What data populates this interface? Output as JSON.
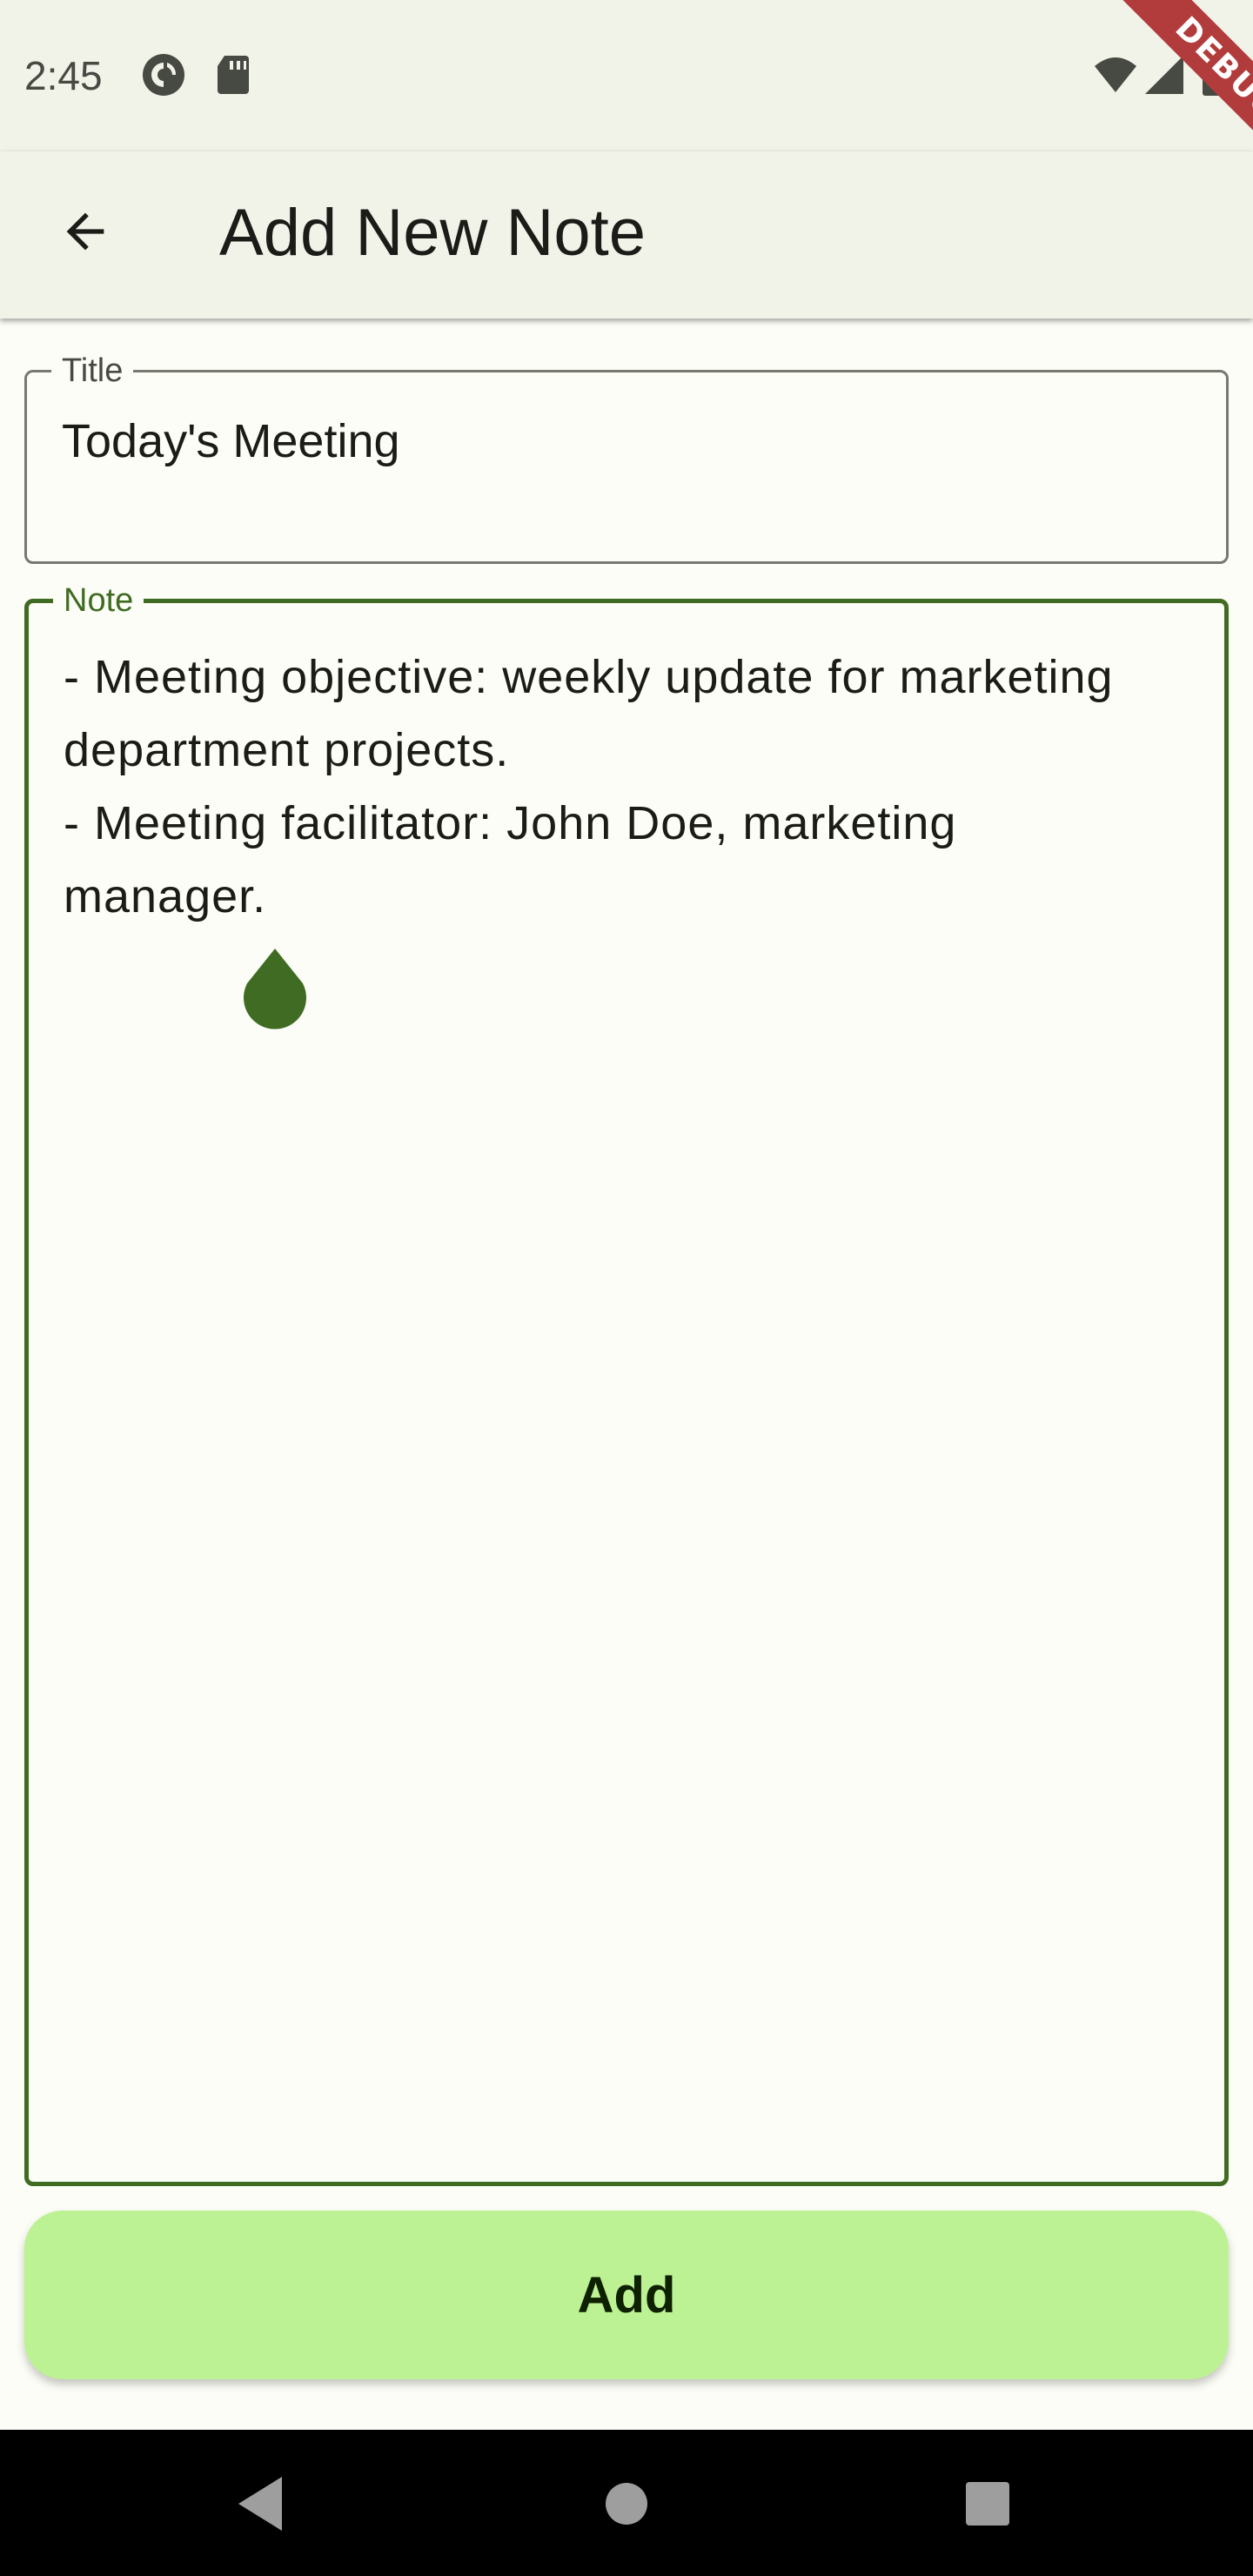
{
  "status_bar": {
    "time": "2:45",
    "icons": [
      "pocket-casts-icon",
      "sd-card-icon",
      "wifi-icon",
      "signal-icon",
      "battery-icon"
    ]
  },
  "debug_banner": "DEBUG",
  "app_bar": {
    "title": "Add New Note",
    "back_icon": "arrow-back-icon"
  },
  "form": {
    "title_field": {
      "label": "Title",
      "value": "Today's Meeting"
    },
    "note_field": {
      "label": "Note",
      "value": "- Meeting objective: weekly update for marketing\ndepartment projects.\n- Meeting facilitator: John Doe, marketing\nmanager."
    }
  },
  "add_button": {
    "label": "Add"
  },
  "nav_bar": {
    "icons": [
      "back-triangle-icon",
      "home-circle-icon",
      "recents-square-icon"
    ]
  },
  "colors": {
    "primary": "#3f6b22",
    "button_bg": "#bdf294",
    "surface": "#fcfdf6",
    "app_bar_bg": "#f1f2e8",
    "debug_red": "#b23b3b"
  }
}
